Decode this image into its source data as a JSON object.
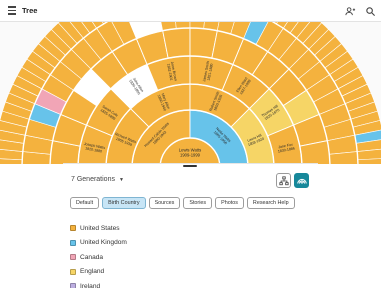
{
  "header": {
    "title": "Tree"
  },
  "legend_colors": {
    "United States": "#f4b23e",
    "United Kingdom": "#67c3ea",
    "Canada": "#f1a5b6",
    "England": "#f6d566",
    "Ireland": "#bcaee0",
    "none": "#ffffff"
  },
  "fan": {
    "center": {
      "name": "Lewis Watts",
      "years": "1909-1999"
    },
    "ring1": [
      {
        "name": "Howard Calvin Watts",
        "years": "1880-1943",
        "color": "United States"
      },
      {
        "name": "Nettie Watts",
        "years": "1885-1958",
        "color": "United Kingdom"
      }
    ],
    "ring2": [
      {
        "name": "Richard Watts",
        "years": "1855-1939",
        "color": "United States"
      },
      {
        "name": "Mary Allen",
        "years": "1860-1940",
        "color": "United States"
      },
      {
        "name": "Robert Smith",
        "years": "1850-1926",
        "color": "United States"
      },
      {
        "name": "Laura Hill",
        "years": "1858-1920",
        "color": "England"
      }
    ],
    "ring3": [
      {
        "name": "Joseph Watts",
        "years": "1820-1880",
        "color": "United States"
      },
      {
        "name": "Sarah Cole",
        "years": "1825-1899",
        "color": "United States"
      },
      {
        "name": "John Allen",
        "years": "1830-1890",
        "color": "none"
      },
      {
        "name": "Anne Brown",
        "years": "1832-1901",
        "color": "United States"
      },
      {
        "name": "James Smith",
        "years": "1821-1880",
        "color": "United States"
      },
      {
        "name": "Ellen Ward",
        "years": "1827-1899",
        "color": "United States"
      },
      {
        "name": "Thomas Hill",
        "years": "1825-1870",
        "color": "England"
      },
      {
        "name": "Jane Fox",
        "years": "1830-1886",
        "color": "United States"
      }
    ]
  },
  "panel": {
    "generations_label": "7 Generations",
    "tabs": [
      "Default",
      "Birth Country",
      "Sources",
      "Stories",
      "Photos",
      "Research Help"
    ],
    "active_tab": "Birth Country",
    "legend": [
      "United States",
      "United Kingdom",
      "Canada",
      "England",
      "Ireland"
    ]
  }
}
